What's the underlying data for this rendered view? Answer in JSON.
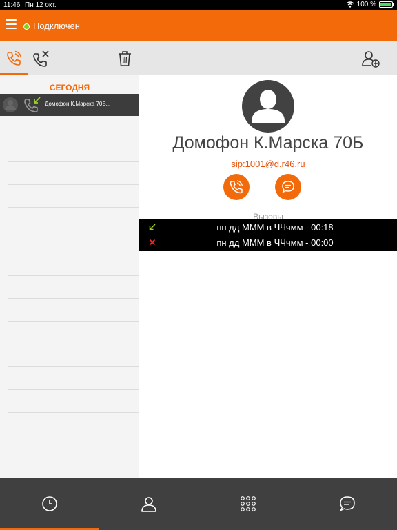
{
  "status_bar": {
    "time": "11:46",
    "date": "Пн 12 окт.",
    "battery": "100 %"
  },
  "header": {
    "status": "Подключен",
    "status_color": "#7ed321"
  },
  "history": {
    "section": "СЕГОДНЯ",
    "items": [
      {
        "name": "Домофон К.Марска 70Б..."
      }
    ]
  },
  "contact": {
    "name": "Домофон К.Марска 70Б",
    "sip": "sip:1001@d.r46.ru",
    "calls_label": "Вызовы",
    "calls": [
      {
        "type": "incoming",
        "text": "пн дд МММ в ЧЧчмм - 00:18"
      },
      {
        "type": "missed",
        "text": "пн дд МММ в ЧЧчмм - 00:00"
      }
    ]
  },
  "colors": {
    "accent": "#f26a0a",
    "incoming": "#9bd12b",
    "missed": "#ff2a2a"
  }
}
